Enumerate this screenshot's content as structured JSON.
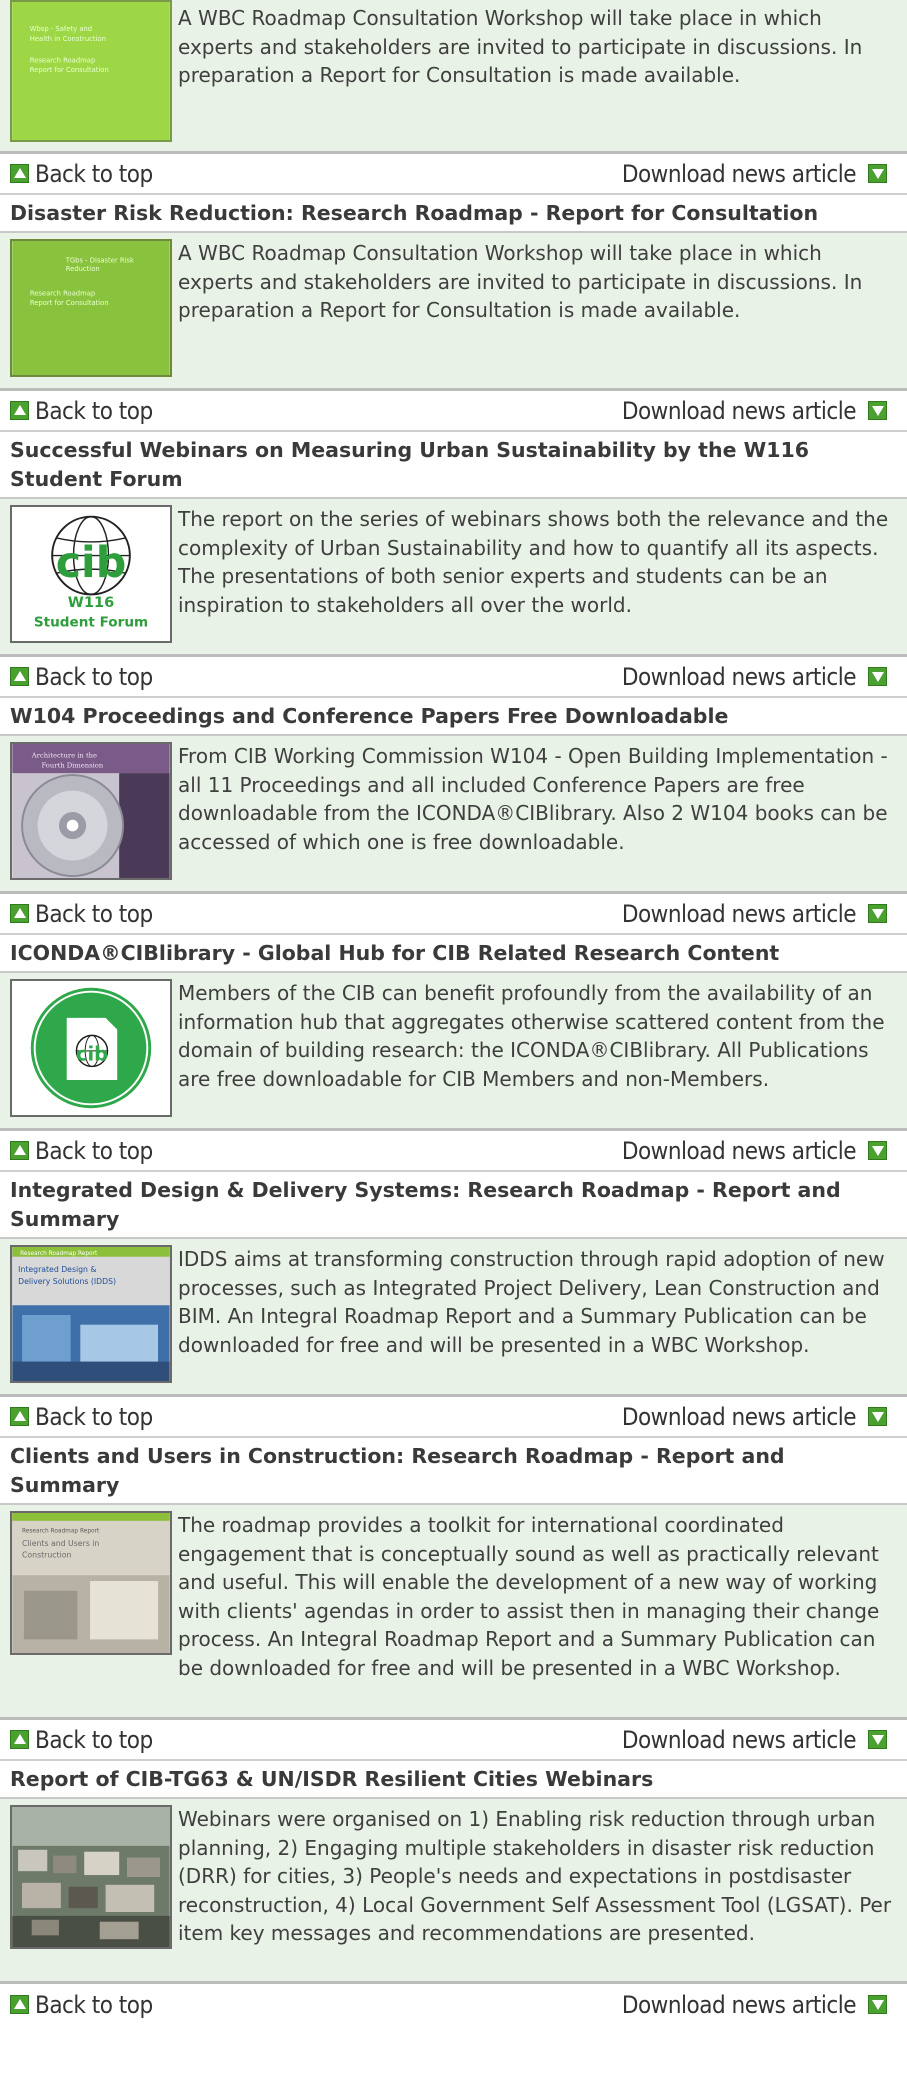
{
  "nav": {
    "back_to_top": "Back to top",
    "download": "Download news article"
  },
  "articles": [
    {
      "title": "",
      "description": "A WBC Roadmap Consultation Workshop will take place in which experts and stakeholders are invited to participate in discussions. In preparation a Report for Consultation is made available.",
      "thumb_lines": [
        "Wbsp - Safety and",
        "Health in Construction",
        "Research Roadmap",
        "Report for Consultation"
      ]
    },
    {
      "title": "Disaster Risk Reduction: Research Roadmap - Report for Consultation",
      "description": "A WBC Roadmap Consultation Workshop will take place in which experts and stakeholders are invited to participate in discussions. In preparation a Report for Consultation is made available.",
      "thumb_lines": [
        "TGbs - Disaster Risk",
        "Reduction",
        "Research Roadmap",
        "Report for Consultation"
      ]
    },
    {
      "title": "Successful Webinars on Measuring Urban Sustainability by the W116 Student Forum",
      "description": "The report on the series of webinars shows both the relevance and the complexity of Urban Sustainability and how to quantify all its aspects. The presentations of both senior experts and students can be an inspiration to stakeholders all over the world.",
      "thumb_lines": [
        "cib",
        "W116",
        "Student Forum"
      ]
    },
    {
      "title": "W104 Proceedings and Conference Papers Free Downloadable",
      "description": "From CIB Working Commission W104 - Open Building Implementation - all 11 Proceedings and all included Conference Papers are free downloadable from the ICONDA®CIBlibrary. Also 2 W104 books can be accessed of which one is free downloadable.",
      "thumb_lines": [
        "Architecture in the",
        "Fourth Dimension"
      ]
    },
    {
      "title": "ICONDA®CIBlibrary - Global Hub for CIB Related Research Content",
      "description": "Members of the CIB can benefit profoundly from the availability of an information hub that aggregates otherwise scattered content from the domain of building research: the ICONDA®CIBlibrary. All Publications are free downloadable for CIB Members and non-Members.",
      "thumb_lines": [
        "cib"
      ]
    },
    {
      "title": "Integrated Design & Delivery Systems: Research Roadmap - Report and Summary",
      "description": "IDDS aims at transforming construction through rapid adoption of new processes, such as Integrated Project Delivery, Lean Construction and BIM. An Integral Roadmap Report and a Summary Publication can be downloaded for free and will be presented in a WBC Workshop.",
      "thumb_lines": [
        "Research Roadmap Report",
        "Integrated Design &",
        "Delivery Solutions (IDDS)"
      ]
    },
    {
      "title": "Clients and Users in Construction: Research Roadmap - Report and Summary",
      "description": "The roadmap provides a toolkit for international coordinated engagement that is conceptually sound as well as practically relevant and useful. This will enable the development of a new way of working with clients' agendas in order to assist then in managing their change process. An Integral Roadmap Report and a Summary Publication can be downloaded for free and will be presented in a WBC Workshop.",
      "thumb_lines": [
        "Research Roadmap Report",
        "Clients and Users in",
        "Construction"
      ]
    },
    {
      "title": "Report of CIB-TG63 & UN/ISDR Resilient Cities Webinars",
      "description": "Webinars were organised on 1) Enabling risk reduction through urban planning, 2) Engaging multiple stakeholders in disaster risk reduction (DRR) for cities, 3) People's needs and expectations in postdisaster reconstruction, 4) Local Government Self Assessment Tool (LGSAT). Per item key messages and recommendations are presented.",
      "thumb_lines": []
    }
  ]
}
